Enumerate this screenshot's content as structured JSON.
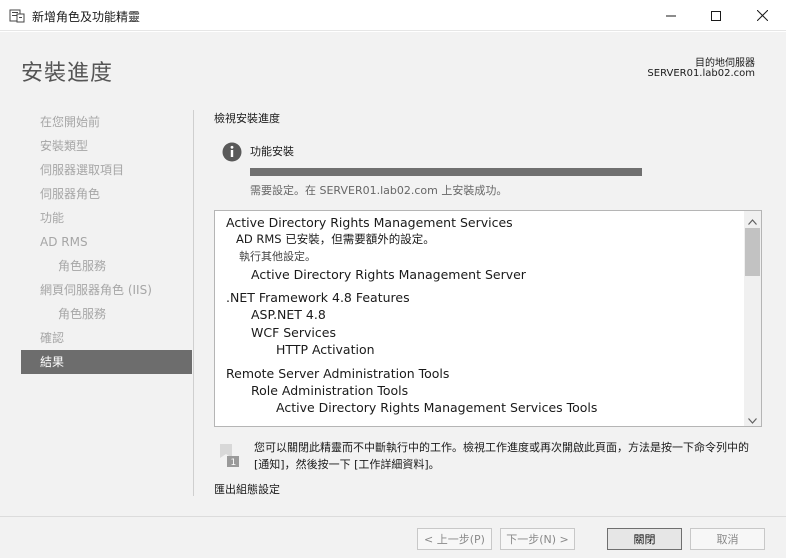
{
  "window": {
    "title": "新增角色及功能精靈",
    "app_icon": "server-manager-icon",
    "controls": [
      "minimize-icon",
      "maximize-icon",
      "close-icon"
    ]
  },
  "header": {
    "page_title": "安裝進度",
    "destination_label": "目的地伺服器",
    "destination_server": "SERVER01.lab02.com"
  },
  "nav": {
    "items": [
      {
        "label": "在您開始前",
        "state": "disabled"
      },
      {
        "label": "安裝類型",
        "state": "disabled"
      },
      {
        "label": "伺服器選取項目",
        "state": "disabled"
      },
      {
        "label": "伺服器角色",
        "state": "disabled"
      },
      {
        "label": "功能",
        "state": "disabled"
      },
      {
        "label": "AD RMS",
        "state": "disabled"
      },
      {
        "label": "角色服務",
        "state": "disabled",
        "sub": true
      },
      {
        "label": "網頁伺服器角色 (IIS)",
        "state": "disabled"
      },
      {
        "label": "角色服務",
        "state": "disabled",
        "sub": true
      },
      {
        "label": "確認",
        "state": "disabled"
      },
      {
        "label": "結果",
        "state": "active"
      }
    ]
  },
  "main": {
    "section_heading": "檢視安裝進度",
    "feature_icon": "info-icon",
    "feature_title": "功能安裝",
    "progress": 1.0,
    "progress_message": "需要設定。在 SERVER01.lab02.com 上安裝成功。",
    "results": [
      {
        "text": "Active Directory Rights Management Services",
        "level": 0
      },
      {
        "text": "AD RMS 已安裝，但需要額外的設定。",
        "level": 1
      },
      {
        "text": "執行其他設定。",
        "level": 1,
        "style": "link"
      },
      {
        "text": "Active Directory Rights Management Server",
        "level": 2
      },
      {
        "text": ".NET Framework 4.8 Features",
        "level": 0
      },
      {
        "text": "ASP.NET 4.8",
        "level": 2
      },
      {
        "text": "WCF Services",
        "level": 2
      },
      {
        "text": "HTTP Activation",
        "level": 3
      },
      {
        "text": "Remote Server Administration Tools",
        "level": 0
      },
      {
        "text": "Role Administration Tools",
        "level": 2
      },
      {
        "text": "Active Directory Rights Management Services Tools",
        "level": 3
      }
    ],
    "note_icon": "notification-flag-icon",
    "note_text": "您可以關閉此精靈而不中斷執行中的工作。檢視工作進度或再次開啟此頁面，方法是按一下命令列中的 [通知]，然後按一下 [工作詳細資料]。",
    "export_link": "匯出組態設定"
  },
  "footer": {
    "prev_label": "< 上一步(P)",
    "next_label": "下一步(N) >",
    "close_label": "關閉",
    "cancel_label": "取消"
  },
  "colors": {
    "active_nav_bg": "#6d6d6d",
    "progress_fill": "#707070",
    "panel_bg": "#f2f2f2"
  }
}
